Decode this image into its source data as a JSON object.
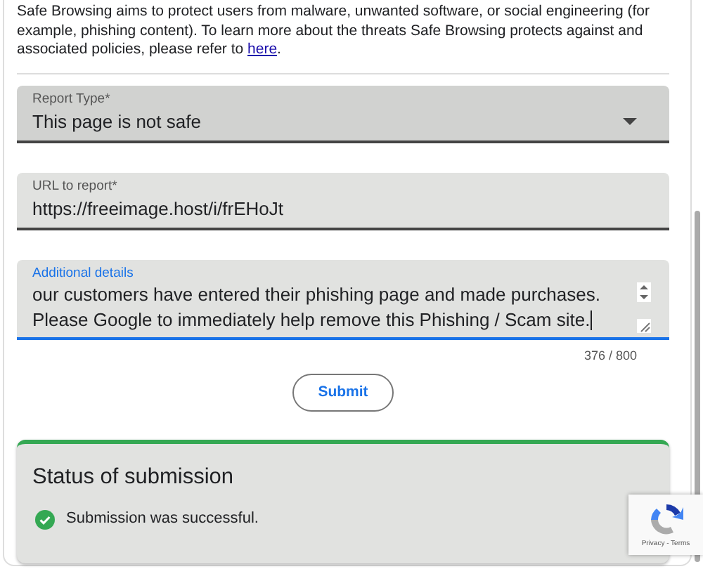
{
  "intro": {
    "text": "Safe Browsing aims to protect users from malware, unwanted software, or social engineering (for example, phishing content). To learn more about the threats Safe Browsing protects against and associated policies, please refer to",
    "link": "here",
    "after": "."
  },
  "fields": [
    {
      "kind": "select",
      "label": "Report Type*",
      "value": "This page is not safe",
      "focused": false
    },
    {
      "kind": "text",
      "label": "URL to report*",
      "value": "https://freeimage.host/i/frEHoJt",
      "focused": false
    },
    {
      "kind": "textarea",
      "label": "Additional details",
      "value": "our customers have entered their phishing page and made purchases. Please Google to immediately help remove this Phishing / Scam site.",
      "focused": true,
      "counter": "376 / 800"
    }
  ],
  "submit": "Submit",
  "status": {
    "title": "Status of submission",
    "message": "Submission was successful."
  },
  "recaptcha": {
    "links": "Privacy - Terms"
  }
}
